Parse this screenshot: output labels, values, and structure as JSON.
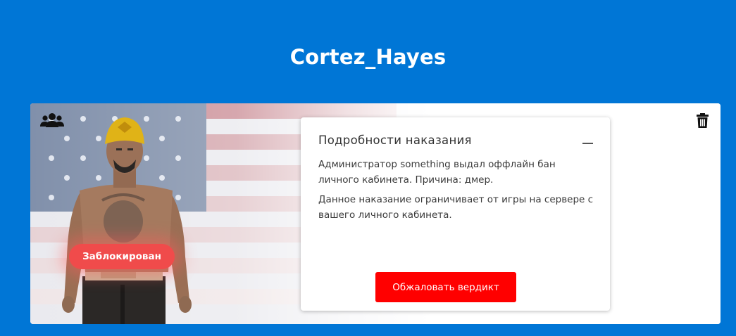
{
  "header": {
    "username": "Cortez_Hayes"
  },
  "profile_card": {
    "status_badge": "Заблокирован",
    "icons": {
      "group": "users-icon",
      "delete": "trash-icon"
    }
  },
  "punishment": {
    "title": "Подробности наказания",
    "description": "Администратор something выдал оффлайн бан личного кабинета. Причина: дмер.",
    "restriction": "Данное наказание ограничивает от игры на сервере с вашего личного кабинета.",
    "appeal_button": "Обжаловать вердикт"
  },
  "colors": {
    "background": "#0076d6",
    "accent_button": "#ff0000",
    "badge": "#f04b4b"
  }
}
